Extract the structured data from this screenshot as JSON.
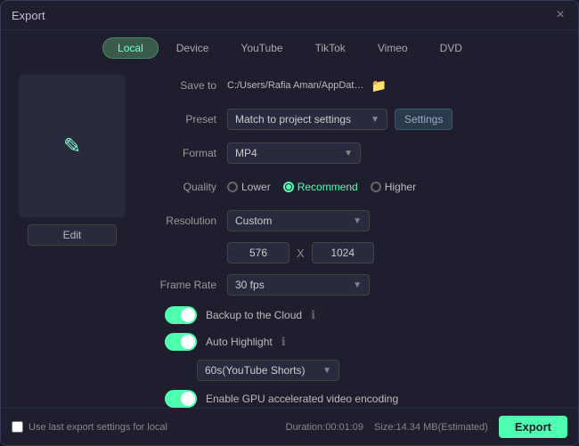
{
  "window": {
    "title": "Export",
    "close_label": "×"
  },
  "tabs": [
    {
      "label": "Local",
      "active": true
    },
    {
      "label": "Device",
      "active": false
    },
    {
      "label": "YouTube",
      "active": false
    },
    {
      "label": "TikTok",
      "active": false
    },
    {
      "label": "Vimeo",
      "active": false
    },
    {
      "label": "DVD",
      "active": false
    }
  ],
  "preview": {
    "edit_label": "Edit",
    "icon": "✎"
  },
  "form": {
    "save_to_label": "Save to",
    "save_to_path": "C:/Users/Rafia Aman/AppDat…",
    "preset_label": "Preset",
    "preset_value": "Match to project settings",
    "settings_label": "Settings",
    "format_label": "Format",
    "format_value": "MP4",
    "quality_label": "Quality",
    "quality_lower": "Lower",
    "quality_recommend": "Recommend",
    "quality_higher": "Higher",
    "resolution_label": "Resolution",
    "resolution_value": "Custom",
    "dim_width": "576",
    "dim_x": "X",
    "dim_height": "1024",
    "framerate_label": "Frame Rate",
    "framerate_value": "30 fps",
    "backup_label": "Backup to the Cloud",
    "auto_highlight_label": "Auto Highlight",
    "shorts_value": "60s(YouTube Shorts)",
    "gpu_label": "Enable GPU accelerated video encoding"
  },
  "footer": {
    "checkbox_label": "Use last export settings for local",
    "duration_label": "Duration:00:01:09",
    "size_label": "Size:14.34 MB(Estimated)",
    "export_label": "Export"
  }
}
